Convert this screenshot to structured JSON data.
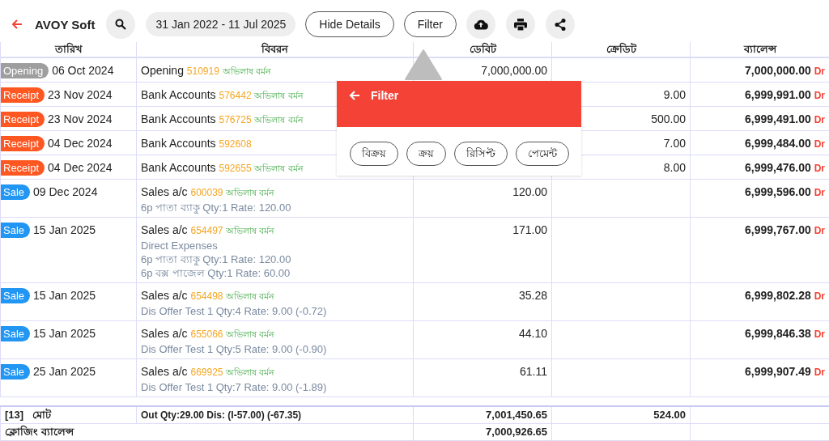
{
  "toolbar": {
    "title": "AVOY Soft",
    "date_range": "31 Jan 2022 - 11 Jul 2025",
    "buttons": [
      "Hide Details",
      "Filter"
    ]
  },
  "table": {
    "columns": [
      "তারিখ",
      "বিবরন",
      "ডেবিট",
      "ক্রেডিট",
      "ব্যালেন্স"
    ],
    "rows": [
      {
        "kind": "opening",
        "tag": "Opening",
        "date": "06 Oct 2024",
        "account": "Opening",
        "voucher": "510919",
        "party": "অভিলাষ বর্মন",
        "details": [],
        "debit": "7,000,000.00",
        "credit": "",
        "balance": "7,000,000.00",
        "side": "Dr"
      },
      {
        "kind": "receipt",
        "tag": "Receipt",
        "date": "23 Nov 2024",
        "account": "Bank Accounts",
        "voucher": "576442",
        "party": "অভিলাষ বর্মন",
        "details": [],
        "debit": "",
        "credit": "9.00",
        "balance": "6,999,991.00",
        "side": "Dr"
      },
      {
        "kind": "receipt",
        "tag": "Receipt",
        "date": "23 Nov 2024",
        "account": "Bank Accounts",
        "voucher": "576725",
        "party": "অভিলাষ বর্মন",
        "details": [],
        "debit": "",
        "credit": "500.00",
        "balance": "6,999,491.00",
        "side": "Dr"
      },
      {
        "kind": "receipt",
        "tag": "Receipt",
        "date": "04 Dec 2024",
        "account": "Bank Accounts",
        "voucher": "592608",
        "details": [],
        "debit": "",
        "credit": "7.00",
        "balance": "6,999,484.00",
        "side": "Dr"
      },
      {
        "kind": "receipt",
        "tag": "Receipt",
        "date": "04 Dec 2024",
        "account": "Bank Accounts",
        "voucher": "592655",
        "party": "অভিলাষ বর্মন",
        "details": [],
        "debit": "",
        "credit": "8.00",
        "balance": "6,999,476.00",
        "side": "Dr"
      },
      {
        "kind": "sale",
        "tag": "Sale",
        "date": "09 Dec 2024",
        "account": "Sales a/c",
        "voucher": "600039",
        "party": "অভিলাষ বর্মন",
        "details": [
          "6p পাতা ব্যাকু Qty:1 Rate: 120.00"
        ],
        "debit": "120.00",
        "credit": "",
        "balance": "6,999,596.00",
        "side": "Dr"
      },
      {
        "kind": "sale",
        "tag": "Sale",
        "date": "15 Jan 2025",
        "account": "Sales a/c",
        "voucher": "654497",
        "party": "অভিলাষ বর্মন",
        "details": [
          "Direct Expenses",
          "6p পাতা ব্যাকু Qty:1 Rate: 120.00",
          "6p বক্স পাজেল Qty:1 Rate: 60.00"
        ],
        "debit": "171.00",
        "credit": "",
        "balance": "6,999,767.00",
        "side": "Dr"
      },
      {
        "kind": "sale",
        "tag": "Sale",
        "date": "15 Jan 2025",
        "account": "Sales a/c",
        "voucher": "654498",
        "party": "অভিলাষ বর্মন",
        "details": [
          "Dis Offer Test 1 Qty:4 Rate: 9.00 (-0.72)"
        ],
        "debit": "35.28",
        "credit": "",
        "balance": "6,999,802.28",
        "side": "Dr"
      },
      {
        "kind": "sale",
        "tag": "Sale",
        "date": "15 Jan 2025",
        "account": "Sales a/c",
        "voucher": "655066",
        "party": "অভিলাষ বর্মন",
        "details": [
          "Dis Offer Test 1 Qty:5 Rate: 9.00 (-0.90)"
        ],
        "debit": "44.10",
        "credit": "",
        "balance": "6,999,846.38",
        "side": "Dr"
      },
      {
        "kind": "sale",
        "tag": "Sale",
        "date": "25 Jan 2025",
        "account": "Sales a/c",
        "voucher": "669925",
        "party": "অভিলাষ বর্মন",
        "details": [
          "Dis Offer Test 1 Qty:7 Rate: 9.00 (-1.89)"
        ],
        "debit": "61.11",
        "credit": "",
        "balance": "6,999,907.49",
        "side": "Dr"
      }
    ],
    "total": {
      "count": "[13]",
      "label": "মোট",
      "summary": "Out Qty:29.00 Dis: (I-57.00) (-67.35)",
      "debit": "7,001,450.65",
      "credit": "524.00"
    },
    "closing": {
      "label": "ক্লোজিং ব্যালেন্স",
      "debit": "7,000,926.65"
    }
  },
  "filter_popover": {
    "title": "Filter",
    "chips": [
      "বিক্রয়",
      "ক্রয়",
      "রিসিপ্ট",
      "পেমেন্ট"
    ]
  }
}
